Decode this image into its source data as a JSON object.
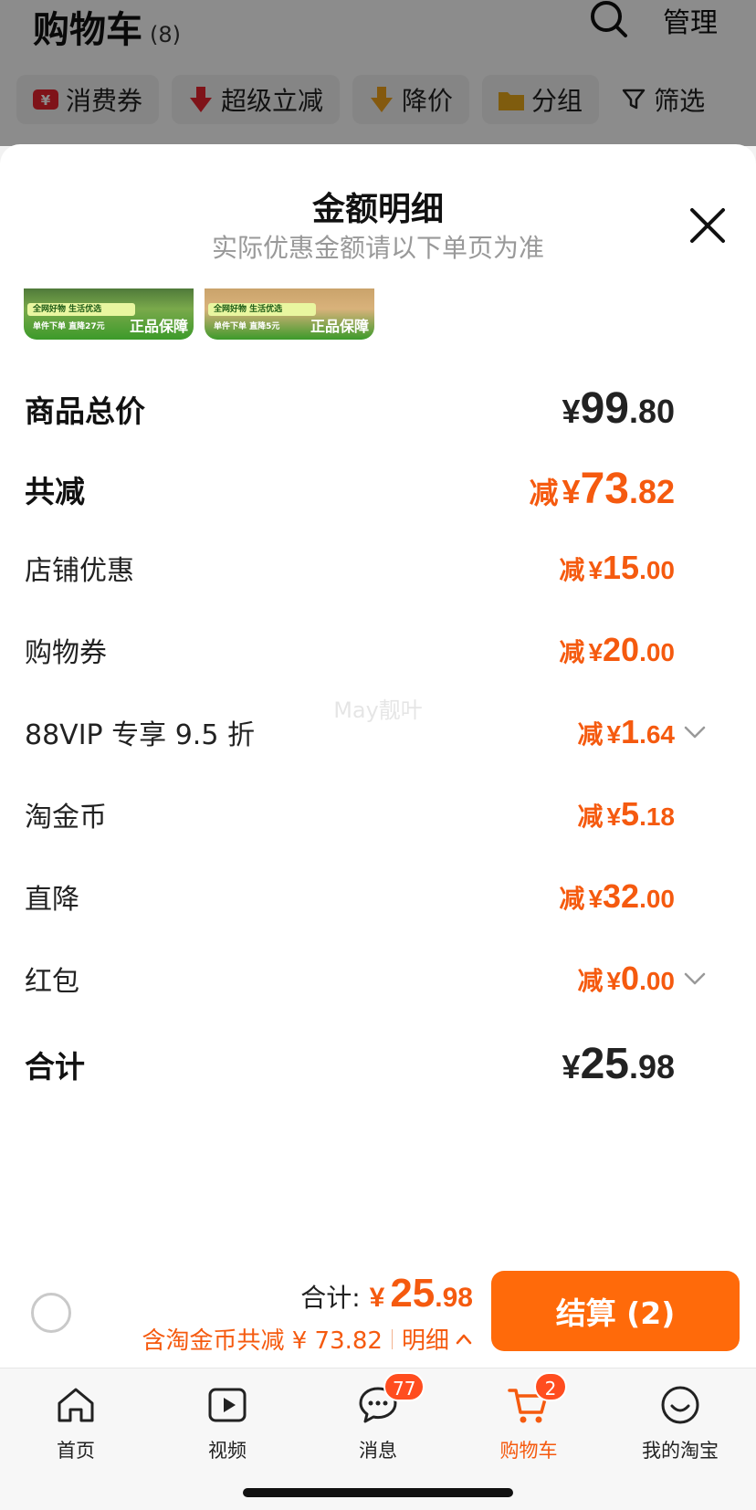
{
  "header": {
    "title": "购物车",
    "count": "(8)",
    "manage": "管理",
    "chips": [
      {
        "icon": "coupon-icon",
        "label": "消费券"
      },
      {
        "icon": "arrow-down-icon",
        "label": "超级立减"
      },
      {
        "icon": "price-drop-icon",
        "label": "降价"
      },
      {
        "icon": "folder-icon",
        "label": "分组"
      },
      {
        "icon": "filter-icon",
        "label": "筛选"
      }
    ]
  },
  "sheet": {
    "title": "金额明细",
    "subtitle": "实际优惠金额请以下单页为准",
    "thumbs": [
      {
        "line1": "全网好物 生活优选",
        "line2": "单件下单 直降27元",
        "badge": "正品保障"
      },
      {
        "line1": "全网好物 生活优选",
        "line2": "单件下单 直降5元",
        "badge": "正品保障"
      }
    ],
    "rows": {
      "total": {
        "label": "商品总价",
        "currency": "¥",
        "int": "99",
        "dec": ".80"
      },
      "discount_total": {
        "label": "共减",
        "prefix": "减",
        "currency": "¥",
        "int": "73",
        "dec": ".82"
      },
      "shop": {
        "label": "店铺优惠",
        "prefix": "减",
        "currency": "¥",
        "int": "15",
        "dec": ".00"
      },
      "coupon": {
        "label": "购物券",
        "prefix": "减",
        "currency": "¥",
        "int": "20",
        "dec": ".00"
      },
      "vip": {
        "label": "88VIP 专享 9.5 折",
        "prefix": "减",
        "currency": "¥",
        "int": "1",
        "dec": ".64"
      },
      "coins": {
        "label": "淘金币",
        "prefix": "减",
        "currency": "¥",
        "int": "5",
        "dec": ".18"
      },
      "direct": {
        "label": "直降",
        "prefix": "减",
        "currency": "¥",
        "int": "32",
        "dec": ".00"
      },
      "redpack": {
        "label": "红包",
        "prefix": "减",
        "currency": "¥",
        "int": "0",
        "dec": ".00"
      },
      "sum": {
        "label": "合计",
        "currency": "¥",
        "int": "25",
        "dec": ".98"
      }
    },
    "watermark": "May靓叶"
  },
  "bottom": {
    "total_label": "合计:",
    "currency": "¥",
    "int": "25",
    "dec": ".98",
    "saving": "含淘金币共减 ¥ 73.82",
    "detail": "明细",
    "checkout": "结算 (2)"
  },
  "tabs": [
    {
      "label": "首页",
      "icon": "home-icon"
    },
    {
      "label": "视频",
      "icon": "video-icon"
    },
    {
      "label": "消息",
      "icon": "message-icon",
      "badge": "77"
    },
    {
      "label": "购物车",
      "icon": "cart-icon",
      "badge": "2"
    },
    {
      "label": "我的淘宝",
      "icon": "smile-icon"
    }
  ],
  "colors": {
    "accent": "#ff6a0a",
    "discount": "#f55a0f",
    "badge": "#ff4d1f"
  }
}
